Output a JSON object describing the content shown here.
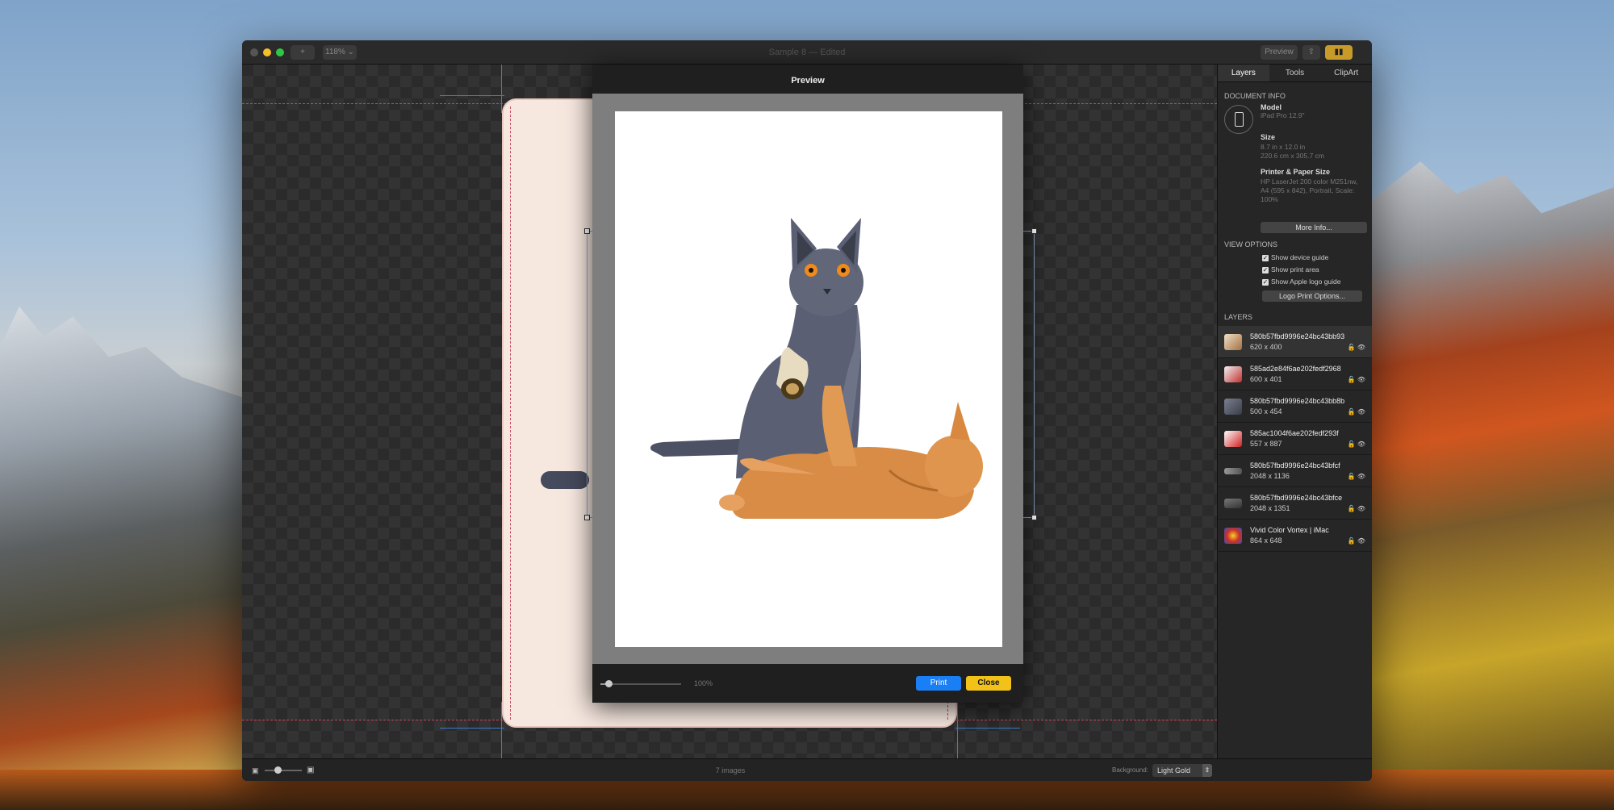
{
  "window": {
    "title": "Sample 8 — Edited",
    "zoom": "118% ⌄",
    "add_label": "+",
    "preview_label": "Preview"
  },
  "sidebar": {
    "tabs": [
      {
        "label": "Layers",
        "active": true
      },
      {
        "label": "Tools"
      },
      {
        "label": "ClipArt"
      }
    ],
    "document_info": {
      "section_title": "DOCUMENT INFO",
      "model_label": "Model",
      "model_value": "iPad Pro 12.9\"",
      "size_label": "Size",
      "size_in": "8.7 in x 12.0 in",
      "size_cm": "220.6 cm x 305.7 cm",
      "printer_label": "Printer & Paper Size",
      "printer_line1": "HP LaserJet 200 color M251nw,",
      "printer_line2": "A4 (595 x 842), Portrait, Scale:",
      "printer_line3": "100%",
      "more_info": "More Info..."
    },
    "view_options": {
      "section_title": "VIEW OPTIONS",
      "options": [
        {
          "label": "Show device guide",
          "checked": true
        },
        {
          "label": "Show print area",
          "checked": true
        },
        {
          "label": "Show Apple logo guide",
          "checked": true
        }
      ],
      "logo_button": "Logo Print Options..."
    },
    "layers": {
      "section_title": "LAYERS",
      "items": [
        {
          "name": "580b57fbd9996e24bc43bb93",
          "dims": "620 x 400"
        },
        {
          "name": "585ad2e84f6ae202fedf2968",
          "dims": "600 x 401"
        },
        {
          "name": "580b57fbd9996e24bc43bb8b",
          "dims": "500 x 454"
        },
        {
          "name": "585ac1004f6ae202fedf293f",
          "dims": "557 x 887"
        },
        {
          "name": "580b57fbd9996e24bc43bfcf",
          "dims": "2048 x 1136"
        },
        {
          "name": "580b57fbd9996e24bc43bfce",
          "dims": "2048 x 1351"
        },
        {
          "name": "Vivid Color Vortex | iMac",
          "dims": "864 x 648"
        }
      ]
    }
  },
  "status": {
    "count": "7 images",
    "background_label": "Background:",
    "background_value": "Light Gold"
  },
  "preview": {
    "title": "Preview",
    "zoom": "100%",
    "zoom_level": 0.1,
    "print": "Print",
    "close": "Close"
  }
}
